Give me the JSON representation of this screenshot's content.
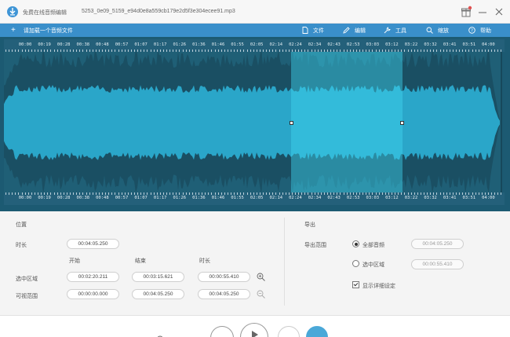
{
  "window": {
    "title": "免费在线音频编辑",
    "file_name": "5253_0e09_5159_e94d0e8a559cb179e2d5f3e304ecee91.mp3",
    "icons": [
      "download-arrow-icon",
      "gift-icon",
      "minimize-icon",
      "close-icon"
    ]
  },
  "toolbar": {
    "add_label": "请加载一个音频文件",
    "file_label": "文件",
    "edit_label": "编辑",
    "tools_label": "工具",
    "zoom_label": "缩放",
    "help_label": "帮助"
  },
  "timeline": {
    "ticks": [
      "00:00",
      "00:19",
      "00:28",
      "00:38",
      "00:48",
      "00:57",
      "01:07",
      "01:17",
      "01:26",
      "01:36",
      "01:46",
      "01:55",
      "02:05",
      "02:14",
      "02:24",
      "02:34",
      "02:43",
      "02:53",
      "03:03",
      "03:12",
      "03:22",
      "03:32",
      "03:41",
      "03:51",
      "04:00"
    ],
    "colors": {
      "background": "#1c5a72",
      "wave_body": "#2aa6c9",
      "wave_dark": "#1d5c70",
      "selection": "#22b8d9"
    }
  },
  "position": {
    "section_title": "位置",
    "duration_label": "时长",
    "duration_value": "00:04:05.250",
    "col_start": "开始",
    "col_end": "结束",
    "col_length": "时长",
    "selection_label": "选中区域",
    "selection_start": "00:02:20.211",
    "selection_end": "00:03:15.621",
    "selection_length": "00:00:55.410",
    "visible_label": "可视范围",
    "visible_start": "00:00:00.000",
    "visible_end": "00:04:05.250",
    "visible_length": "00:04:05.250"
  },
  "export": {
    "section_title": "导出",
    "range_label": "导出范围",
    "all_label": "全部音频",
    "all_value": "00:04:05.250",
    "selection_label": "选中区域",
    "selection_value": "00:00:55.410",
    "details_label": "显示详细设定"
  }
}
